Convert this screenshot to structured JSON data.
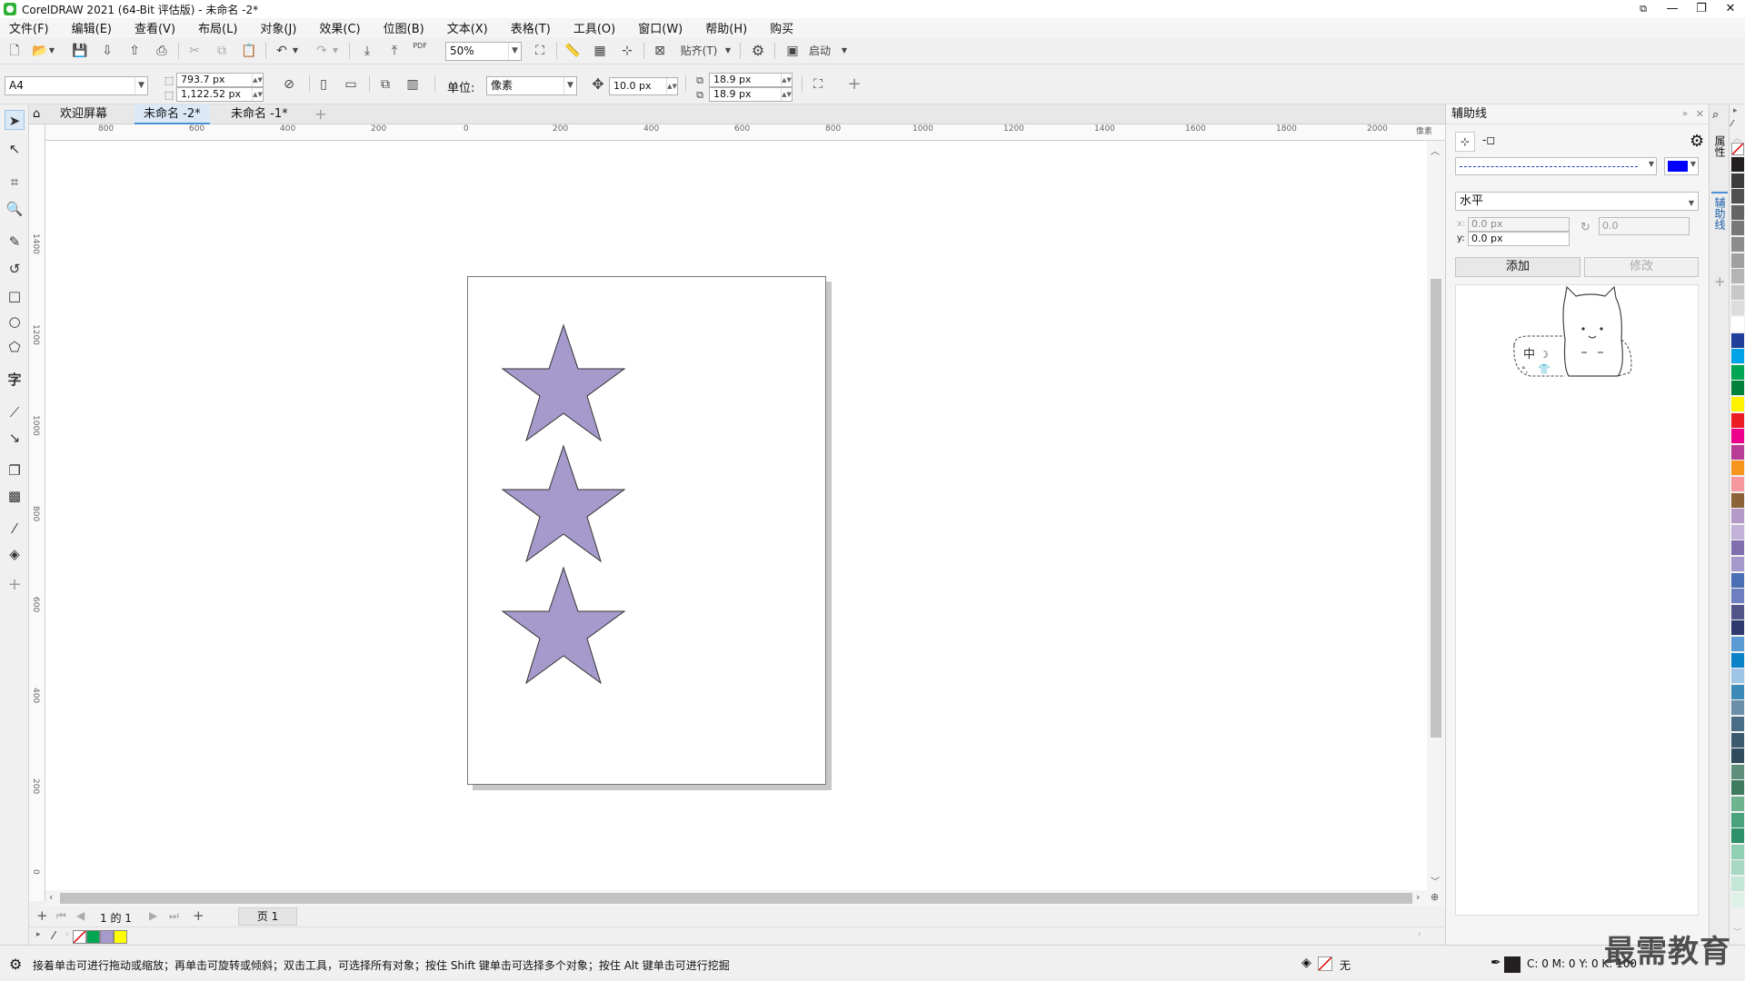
{
  "app": {
    "title": "CorelDRAW 2021 (64-Bit 评估版) - 未命名 -2*"
  },
  "window_controls": {
    "minimize": "—",
    "restore": "❐",
    "close": "✕"
  },
  "menu": [
    "文件(F)",
    "编辑(E)",
    "查看(V)",
    "布局(L)",
    "对象(J)",
    "效果(C)",
    "位图(B)",
    "文本(X)",
    "表格(T)",
    "工具(O)",
    "窗口(W)",
    "帮助(H)",
    "购买"
  ],
  "toolbar": {
    "zoom_value": "50%",
    "snap_label": "贴齐(T)",
    "launch_label": "启动",
    "pdf_label": "PDF"
  },
  "propbar": {
    "page_size": "A4",
    "width": "793.7 px",
    "height": "1,122.52 px",
    "unit_label": "单位:",
    "unit_value": "像素",
    "nudge": "10.0 px",
    "dup_x": "18.9 px",
    "dup_y": "18.9 px"
  },
  "tabs": [
    {
      "label": "欢迎屏幕"
    },
    {
      "label": "未命名 -2*"
    },
    {
      "label": "未命名 -1*"
    }
  ],
  "ruler": {
    "h_ticks": [
      "800",
      "600",
      "400",
      "200",
      "0",
      "200",
      "400",
      "600",
      "800",
      "1000",
      "1200",
      "1400",
      "1600",
      "1800",
      "2000"
    ],
    "h_unit": "像素",
    "v_ticks": [
      "1400",
      "1200",
      "1000",
      "800",
      "600",
      "400",
      "200",
      "0"
    ],
    "v_unit": "像素"
  },
  "pagenav": {
    "page_count": "1 的 1",
    "page_tab": "页 1"
  },
  "status": {
    "hint": "接着单击可进行拖动或缩放；再单击可旋转或倾斜；双击工具，可选择所有对象；按住 Shift 键单击可选择多个对象；按住 Alt 键单击可进行挖掘",
    "fill_label": "无",
    "cmyk": "C: 0 M: 0 Y: 0 K: 100"
  },
  "docker": {
    "title": "辅助线",
    "direction": "水平",
    "x_value": "0.0 px",
    "y_value": "0.0 px",
    "angle_value": "0.0",
    "x_label": "x:",
    "y_label": "y:",
    "add_button": "添加",
    "modify_button": "修改",
    "guide_color": "#0000ff",
    "mascot_text": "中"
  },
  "docker_tabs": [
    "属性",
    "辅助线"
  ],
  "colors": {
    "star_fill": "#a59acb",
    "accent": "#4a90d9"
  },
  "document_palette": [
    "#ffffff",
    "#00a651",
    "#a59acb",
    "#ffff00"
  ],
  "color_palette": [
    "#231f20",
    "#3c3c3c",
    "#505050",
    "#646464",
    "#787878",
    "#8c8c8c",
    "#a0a0a0",
    "#b4b4b4",
    "#c8c8c8",
    "#dcdcdc",
    "#ffffff",
    "#1f3f9a",
    "#00a2e8",
    "#00a651",
    "#00823c",
    "#fff200",
    "#ed1c24",
    "#ec008c",
    "#b83d96",
    "#f7941d",
    "#f6989d",
    "#8c6239",
    "#b49ac9",
    "#c2b2d9",
    "#7f6faf",
    "#a59acb",
    "#4b6fb5",
    "#6d7fc0",
    "#51558a",
    "#2e3a6e",
    "#5b9bd5",
    "#0a82c8",
    "#9fc6e6",
    "#3c8ab8",
    "#6b8fa8",
    "#4a6d86",
    "#3c5a6e",
    "#2f4b5c",
    "#5f8f7c",
    "#3e7a5e",
    "#6fb38f",
    "#4aa37c",
    "#2e8f6b",
    "#8fd0b5",
    "#a7d8c4",
    "#c3e6d6",
    "#dff2e8"
  ],
  "watermark": "最需教育"
}
